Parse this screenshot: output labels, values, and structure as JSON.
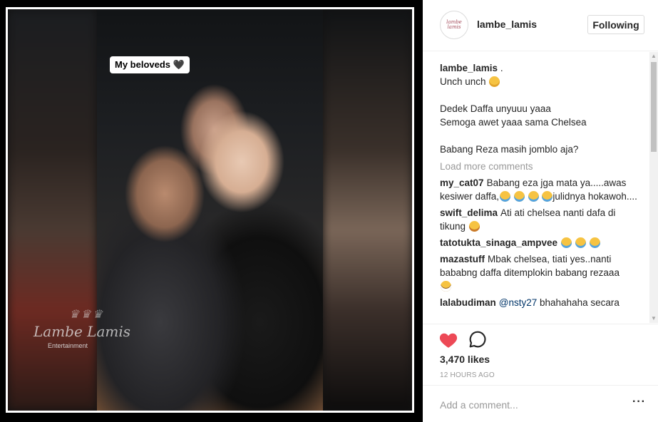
{
  "post": {
    "sticker_text": "My beloveds 🖤",
    "watermark_title": "Lambe Lamis",
    "watermark_subtitle": "Entertainment"
  },
  "header": {
    "username": "lambe_lamis",
    "avatar_text": "lambe lamis",
    "follow_label": "Following"
  },
  "caption": {
    "author": "lambe_lamis",
    "first_line": ".",
    "lines": [
      "Unch unch",
      "",
      "Dedek Daffa unyuuu yaaa",
      "Semoga awet yaaa sama Chelsea",
      "",
      "Babang Reza masih jomblo aja?"
    ]
  },
  "load_more_label": "Load more comments",
  "comments": [
    {
      "user": "my_cat07",
      "text_a": "Babang eza jga mata ya.....awas kesiwer daffa,",
      "text_b": "julidnya hokawoh...."
    },
    {
      "user": "swift_delima",
      "text": "Ati ati chelsea nanti dafa di tikung"
    },
    {
      "user": "tatotukta_sinaga_ampvee",
      "text": ""
    },
    {
      "user": "mazastuff",
      "text": "Mbak chelsea, tiati yes..nanti bababng daffa ditemplokin babang rezaaa"
    },
    {
      "user": "lalabudiman",
      "mention": "@nsty27",
      "text": "bhahahaha secara"
    }
  ],
  "actions": {
    "likes": "3,470 likes",
    "timestamp": "12 HOURS AGO"
  },
  "add_comment": {
    "placeholder": "Add a comment..."
  },
  "icons": {
    "like": "heart-icon",
    "comment": "comment-bubble-icon",
    "more": "more-options-icon"
  },
  "colors": {
    "like_red": "#ed4956",
    "mention_blue": "#003569",
    "muted_gray": "#999999"
  }
}
